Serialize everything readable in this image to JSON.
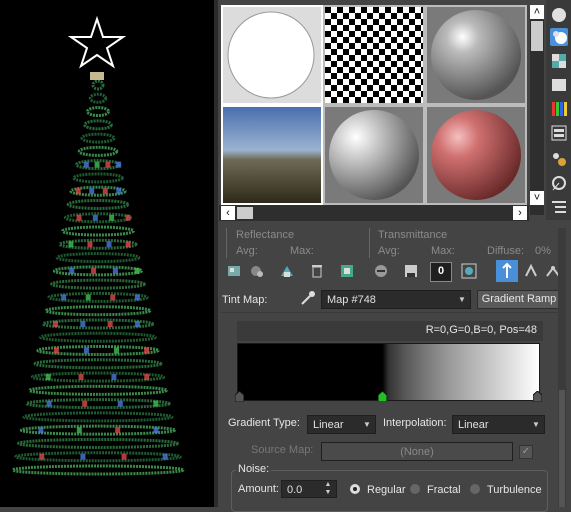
{
  "slots": {
    "labels": [
      "Reflectance",
      "Transmittance"
    ],
    "avg_label": "Avg:",
    "max_label": "Max:",
    "diffuse_label": "Diffuse:",
    "diffuse_value": "0%"
  },
  "tint_map": {
    "label": "Tint Map:",
    "map_name": "Map #748",
    "type_button": "Gradient Ramp"
  },
  "gradient": {
    "info": "R=0,G=0,B=0, Pos=48",
    "gradient_type_label": "Gradient Type:",
    "gradient_type_value": "Linear",
    "interpolation_label": "Interpolation:",
    "interpolation_value": "Linear",
    "source_map_label": "Source Map:",
    "source_map_value": "(None)"
  },
  "noise": {
    "group_label": "Noise:",
    "amount_label": "Amount:",
    "amount_value": "0.0",
    "options": [
      "Regular",
      "Fractal",
      "Turbulence"
    ],
    "selected": "Regular"
  },
  "toolbar": {
    "count_value": "0"
  },
  "icons": [
    "sample-slot-icon",
    "background-icon",
    "checker-icon",
    "video-color-check-icon",
    "make-preview-icon",
    "options-icon",
    "select-by-material-icon",
    "material-navigator-icon",
    "eyedropper-icon"
  ],
  "colors": {
    "panel_bg": "#444444",
    "field_bg": "#2b2b2b",
    "accent_blue": "#4a90d9",
    "marker_green": "#22c022",
    "viewport_bg": "#000000"
  }
}
